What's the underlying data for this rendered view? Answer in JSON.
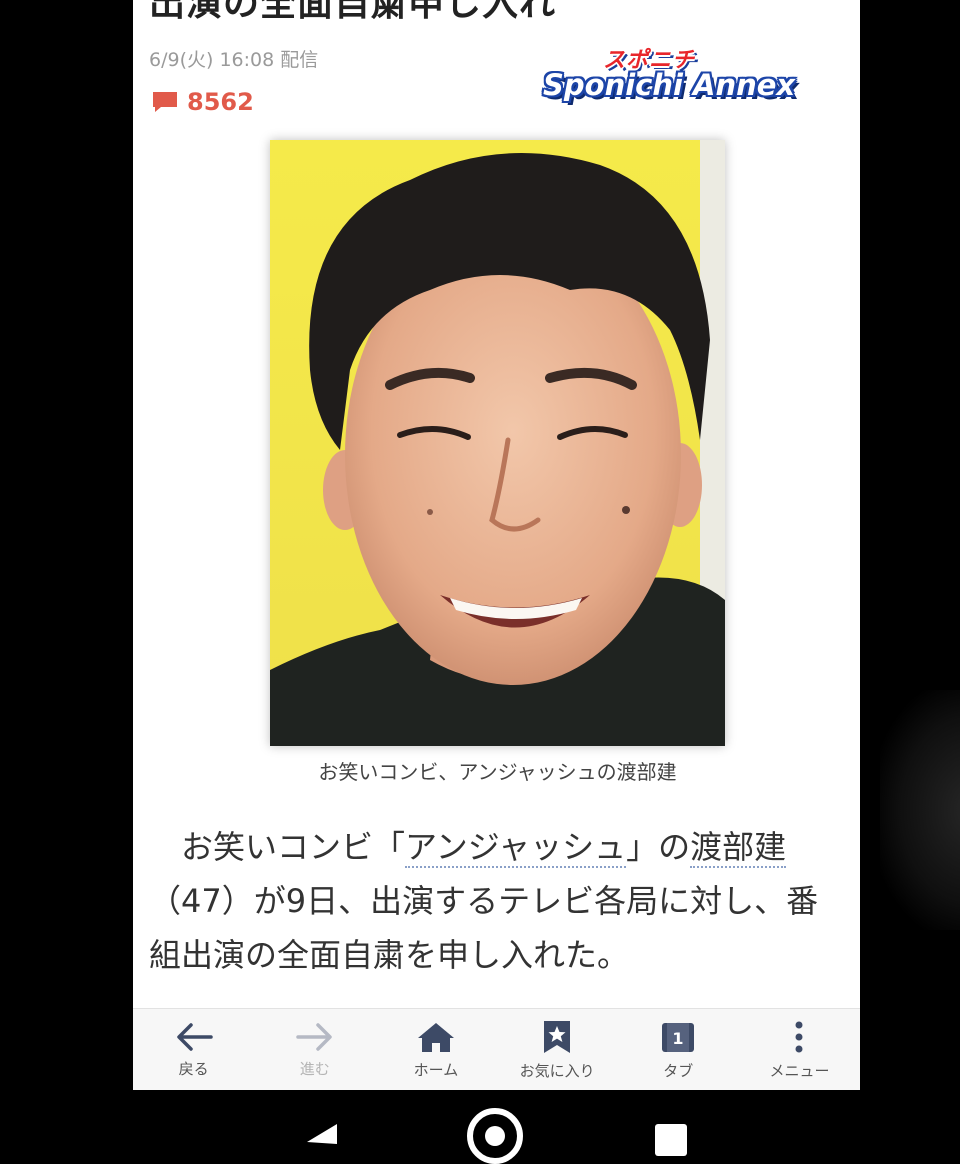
{
  "article": {
    "headline": "出演の全面自粛申し入れ",
    "published": "6/9(火) 16:08 配信",
    "comment_count": "8562",
    "logo_kana": "スポニチ",
    "logo_name": "Sponichi Annex",
    "photo_caption": "お笑いコンビ、アンジャッシュの渡部建",
    "body_part1": "お笑いコンビ「",
    "body_link1": "アンジャッシュ",
    "body_part2": "」の",
    "body_link2": "渡部建",
    "body_part3": "（47）が9日、出演するテレビ各局に対し、番組出演の全面自粛を申し入れた。"
  },
  "navbar": {
    "back": "戻る",
    "forward": "進む",
    "home": "ホーム",
    "favorites": "お気に入り",
    "tabs": "タブ",
    "tab_count": "1",
    "menu": "メニュー"
  },
  "colors": {
    "comment_red": "#e15a4a",
    "nav_icon": "#3d4a66",
    "logo_blue": "#1d45a8",
    "logo_red": "#e8262b",
    "photo_background": "#f3e646"
  }
}
